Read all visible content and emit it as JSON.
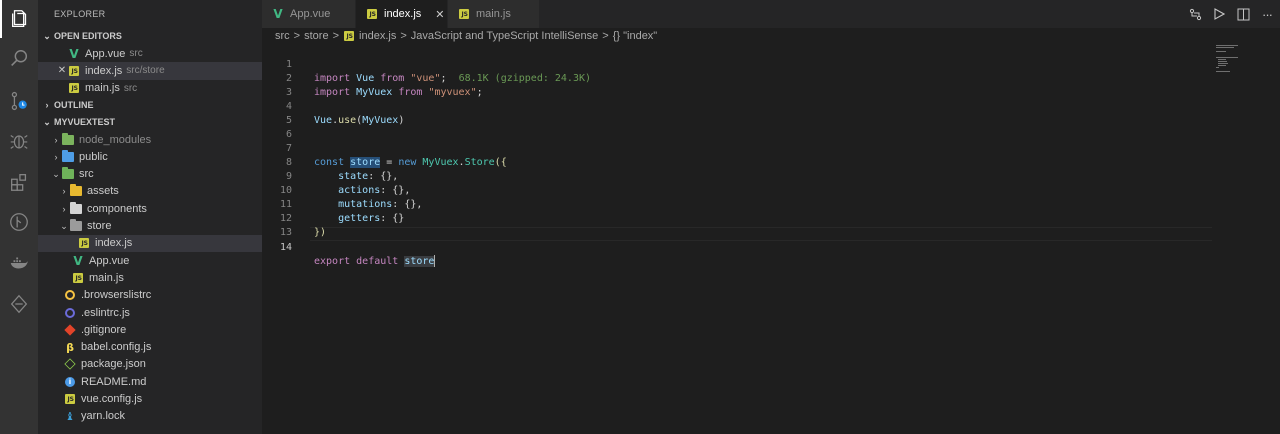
{
  "sidebar": {
    "title": "EXPLORER",
    "open_editors": {
      "header": "OPEN EDITORS",
      "items": [
        {
          "name": "App.vue",
          "desc": "src"
        },
        {
          "name": "index.js",
          "desc": "src/store"
        },
        {
          "name": "main.js",
          "desc": "src"
        }
      ]
    },
    "outline_header": "OUTLINE",
    "project_header": "MYVUEXTEST",
    "tree": [
      {
        "label": "node_modules"
      },
      {
        "label": "public"
      },
      {
        "label": "src"
      },
      {
        "label": "assets"
      },
      {
        "label": "components"
      },
      {
        "label": "store"
      },
      {
        "label": "index.js"
      },
      {
        "label": "App.vue"
      },
      {
        "label": "main.js"
      },
      {
        "label": ".browserslistrc"
      },
      {
        "label": ".eslintrc.js"
      },
      {
        "label": ".gitignore"
      },
      {
        "label": "babel.config.js"
      },
      {
        "label": "package.json"
      },
      {
        "label": "README.md"
      },
      {
        "label": "vue.config.js"
      },
      {
        "label": "yarn.lock"
      }
    ]
  },
  "tabs": [
    {
      "label": "App.vue"
    },
    {
      "label": "index.js"
    },
    {
      "label": "main.js"
    }
  ],
  "tab_close_glyph": "✕",
  "breadcrumb": {
    "parts": [
      "src",
      "store",
      "index.js",
      "JavaScript and TypeScript IntelliSense",
      "{} \"index\""
    ],
    "sep": ">"
  },
  "editor": {
    "line_numbers": [
      "1",
      "2",
      "3",
      "4",
      "5",
      "6",
      "7",
      "8",
      "9",
      "10",
      "11",
      "12",
      "13",
      "14"
    ],
    "tokens": {
      "import": "import",
      "vue_ident": "Vue",
      "from": "from",
      "vue_str": "\"vue\"",
      "semicolon": ";",
      "size_hint": "68.1K (gzipped: 24.3K)",
      "myvuex_ident": "MyVuex",
      "myvuex_str": "\"myvuex\"",
      "vue_use": "Vue",
      "use_fn": "use",
      "use_arg": "MyVuex",
      "const": "const",
      "store": "store",
      "eq": " = ",
      "new": "new",
      "store_cls": "MyVuex",
      "store_prop": "Store",
      "open": "({",
      "state": "state",
      "actions": "actions",
      "mutations": "mutations",
      "getters": "getters",
      "empty_obj_comma": ": {},",
      "empty_obj": ": {}",
      "close": "})",
      "export": "export",
      "default": "default",
      "store_end": "store"
    }
  }
}
